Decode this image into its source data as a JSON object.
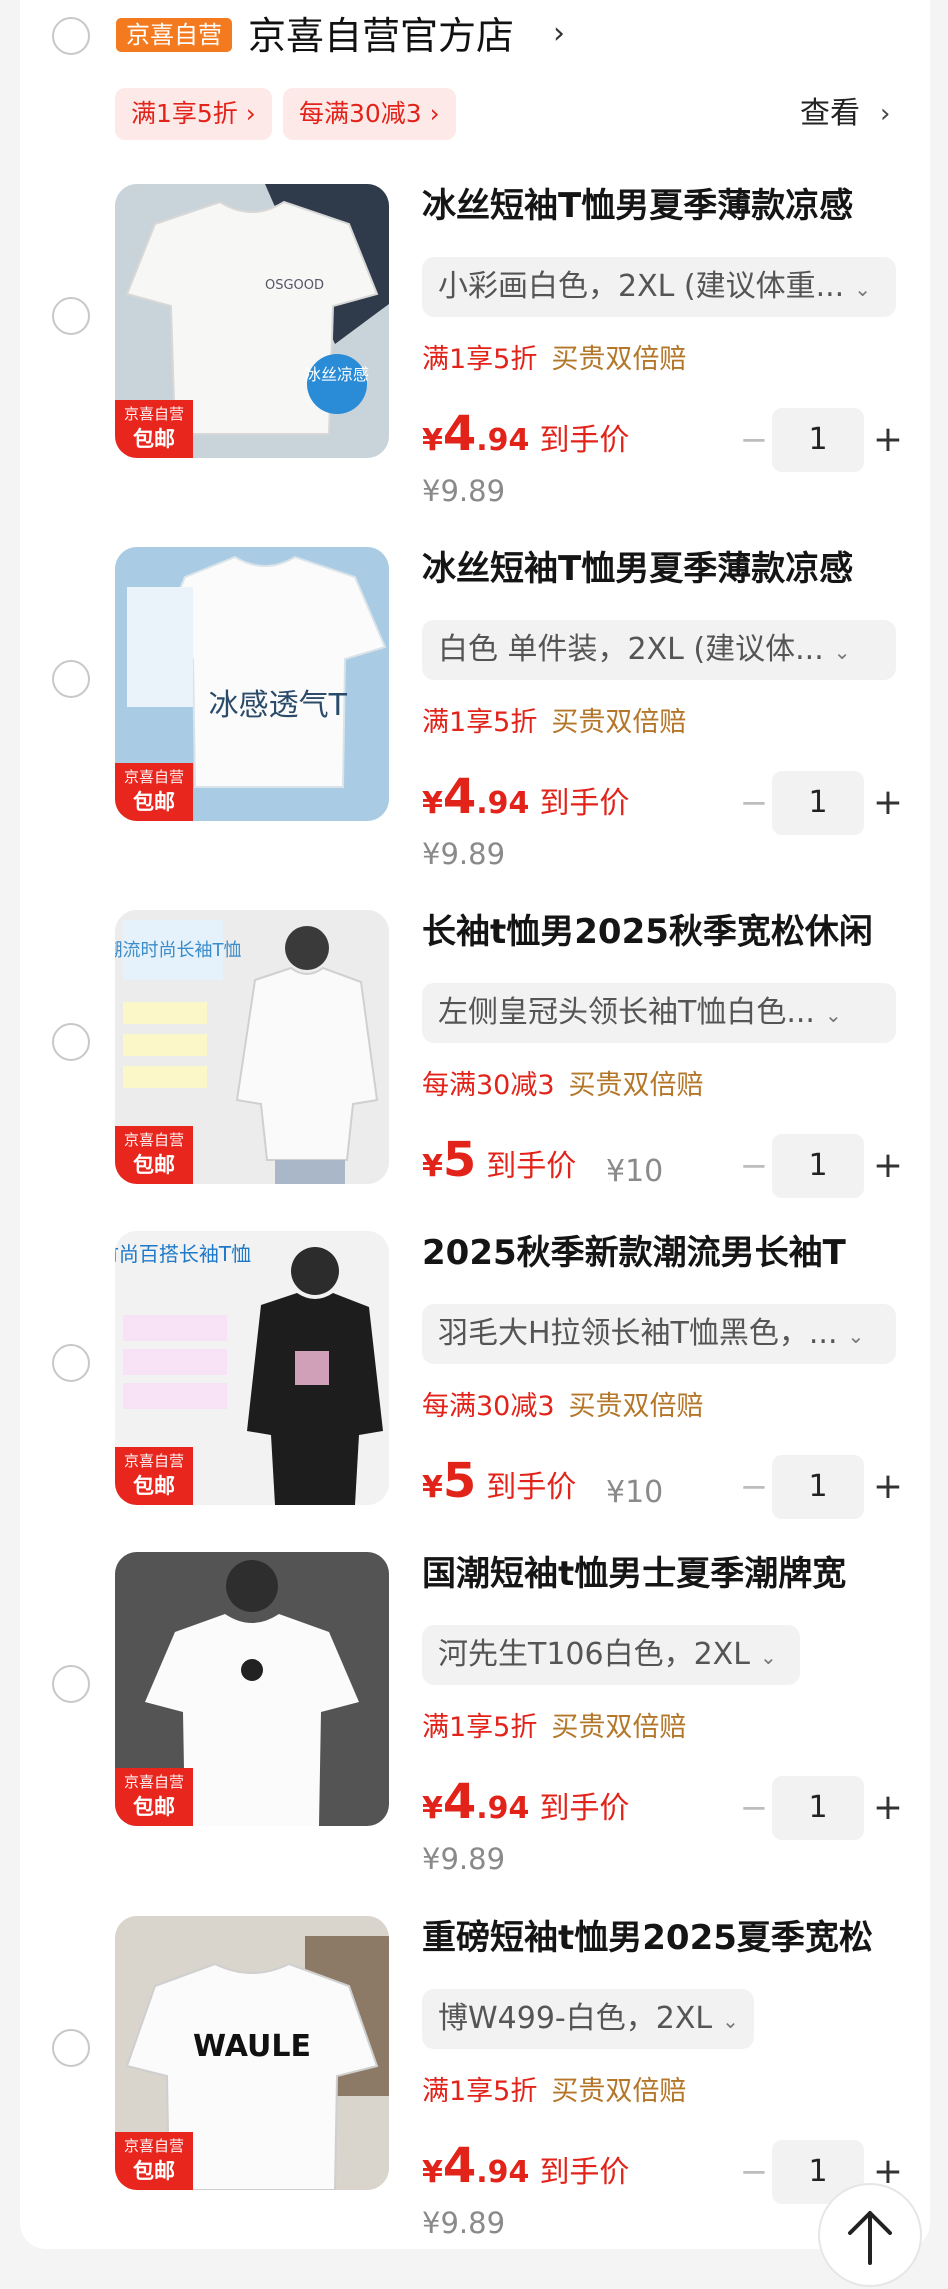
{
  "store": {
    "badge": "京喜自营",
    "name": "京喜自营官方店",
    "arrow": "›",
    "promos": [
      "满1享5折 ›",
      "每满30减3 ›"
    ],
    "view_label": "查看",
    "view_arrow": "›"
  },
  "corner_badge": {
    "line1": "京喜自营",
    "line2": "包邮"
  },
  "items": [
    {
      "title": "冰丝短袖T恤男夏季薄款凉感",
      "spec": "小彩画白色，2XL (建议体重...",
      "tag1": "满1享5折",
      "tag2": "买贵双倍赔",
      "currency": "¥",
      "price_int": "4",
      "price_dec": ".94",
      "price_suffix": "到手价",
      "original": "¥9.89",
      "qty": "1",
      "thumb_text": "冰丝凉感"
    },
    {
      "title": "冰丝短袖T恤男夏季薄款凉感",
      "spec": "白色 单件装，2XL (建议体...",
      "tag1": "满1享5折",
      "tag2": "买贵双倍赔",
      "currency": "¥",
      "price_int": "4",
      "price_dec": ".94",
      "price_suffix": "到手价",
      "original": "¥9.89",
      "qty": "1",
      "thumb_text": "冰感透气T"
    },
    {
      "title": "长袖t恤男2025秋季宽松休闲",
      "spec": "左侧皇冠头领长袖T恤白色...",
      "tag1": "每满30减3",
      "tag2": "买贵双倍赔",
      "currency": "¥",
      "price_int": "5",
      "price_dec": "",
      "price_suffix": "到手价",
      "original": "¥10",
      "qty": "1",
      "thumb_text": "潮流时尚长袖T恤"
    },
    {
      "title": "2025秋季新款潮流男长袖T",
      "spec": "羽毛大H拉领长袖T恤黑色，...",
      "tag1": "每满30减3",
      "tag2": "买贵双倍赔",
      "currency": "¥",
      "price_int": "5",
      "price_dec": "",
      "price_suffix": "到手价",
      "original": "¥10",
      "qty": "1",
      "thumb_text": "时尚百搭长袖T恤"
    },
    {
      "title": "国潮短袖t恤男士夏季潮牌宽",
      "spec": "河先生T106白色，2XL",
      "tag1": "满1享5折",
      "tag2": "买贵双倍赔",
      "currency": "¥",
      "price_int": "4",
      "price_dec": ".94",
      "price_suffix": "到手价",
      "original": "¥9.89",
      "qty": "1",
      "thumb_text": ""
    },
    {
      "title": "重磅短袖t恤男2025夏季宽松",
      "spec": "博W499-白色，2XL",
      "tag1": "满1享5折",
      "tag2": "买贵双倍赔",
      "currency": "¥",
      "price_int": "4",
      "price_dec": ".94",
      "price_suffix": "到手价",
      "original": "¥9.89",
      "qty": "1",
      "thumb_text": "WAULE"
    }
  ],
  "stepper": {
    "minus": "−",
    "plus": "+"
  },
  "spec_chevron": "⌄",
  "colors": {
    "accent_red": "#e2231a",
    "badge_orange": "#f47a1f",
    "gold": "#b4772a"
  },
  "icons": {
    "back_to_top": "arrow-up-icon"
  }
}
